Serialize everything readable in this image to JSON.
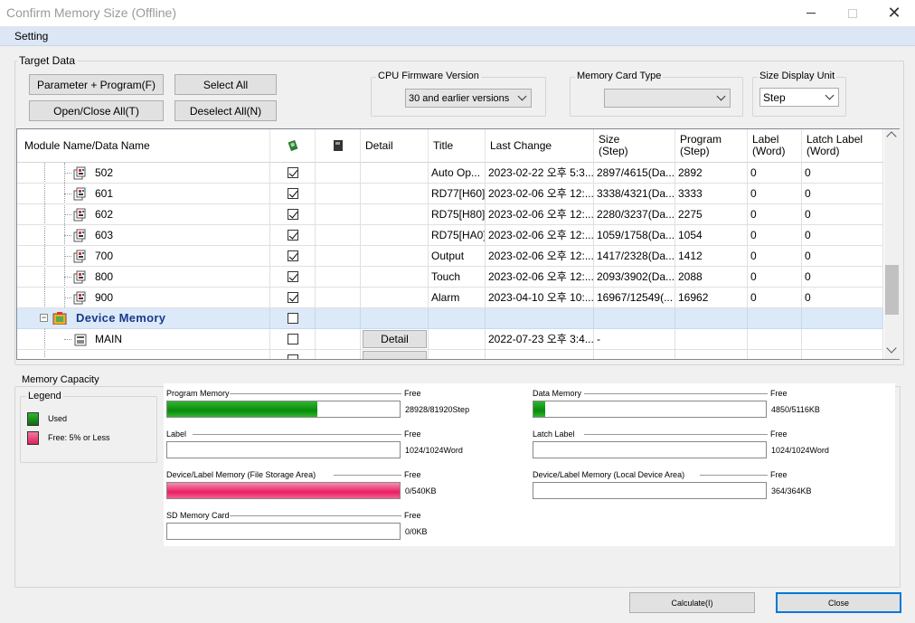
{
  "window": {
    "title": "Confirm Memory Size (Offline)"
  },
  "menu": {
    "setting": "Setting"
  },
  "target": {
    "group_title": "Target Data",
    "btn_param": "Parameter + Program(F)",
    "btn_open_close": "Open/Close All(T)",
    "btn_select_all": "Select All",
    "btn_deselect_all": "Deselect All(N)",
    "cpu_fw_label": "CPU Firmware Version",
    "cpu_fw_value": "30 and earlier versions",
    "card_label": "Memory Card Type",
    "card_value": "",
    "unit_label": "Size Display Unit",
    "unit_value": "Step"
  },
  "grid": {
    "headers": {
      "name": "Module Name/Data Name",
      "col_module_icon": "module-chip-icon",
      "col_card_icon": "memory-card-icon",
      "detail": "Detail",
      "title": "Title",
      "last_change": "Last Change",
      "size": "Size\n(Step)",
      "program": "Program\n(Step)",
      "label": "Label\n(Word)",
      "latch": "Latch Label\n(Word)"
    },
    "rows": [
      {
        "name": "502",
        "checked": true,
        "title": "Auto Op...",
        "last_change": "2023-02-22 오후 5:3...",
        "size": "2897/4615(Da...",
        "program": "2892",
        "label": "0",
        "latch": "0"
      },
      {
        "name": "601",
        "checked": true,
        "title": "RD77[H60]",
        "last_change": "2023-02-06 오후 12:...",
        "size": "3338/4321(Da...",
        "program": "3333",
        "label": "0",
        "latch": "0"
      },
      {
        "name": "602",
        "checked": true,
        "title": "RD75[H80]",
        "last_change": "2023-02-06 오후 12:...",
        "size": "2280/3237(Da...",
        "program": "2275",
        "label": "0",
        "latch": "0"
      },
      {
        "name": "603",
        "checked": true,
        "title": "RD75[HA0]",
        "last_change": "2023-02-06 오후 12:...",
        "size": "1059/1758(Da...",
        "program": "1054",
        "label": "0",
        "latch": "0"
      },
      {
        "name": "700",
        "checked": true,
        "title": "Output",
        "last_change": "2023-02-06 오후 12:...",
        "size": "1417/2328(Da...",
        "program": "1412",
        "label": "0",
        "latch": "0"
      },
      {
        "name": "800",
        "checked": true,
        "title": "Touch",
        "last_change": "2023-02-06 오후 12:...",
        "size": "2093/3902(Da...",
        "program": "2088",
        "label": "0",
        "latch": "0"
      },
      {
        "name": "900",
        "checked": true,
        "title": "Alarm",
        "last_change": "2023-04-10 오후 10:...",
        "size": "16967/12549(...",
        "program": "16962",
        "label": "0",
        "latch": "0"
      }
    ],
    "device_memory": {
      "name": "Device Memory",
      "checked": false
    },
    "main_row": {
      "name": "MAIN",
      "checked": false,
      "detail": "Detail",
      "last_change": "2022-07-23 오후 3:4...",
      "size": "-"
    }
  },
  "capacity": {
    "group_title": "Memory Capacity",
    "legend_title": "Legend",
    "legend_used": "Used",
    "legend_free": "Free: 5% or Less",
    "free_word": "Free",
    "colors": {
      "used": "#1aa01a",
      "free_low": "#e8457a"
    },
    "items": {
      "program": {
        "label": "Program Memory",
        "value": "28928/81920Step",
        "used_fraction": 0.647
      },
      "data": {
        "label": "Data Memory",
        "value": "4850/5116KB",
        "used_fraction": 0.052
      },
      "label": {
        "label": "Label",
        "value": "1024/1024Word",
        "used_fraction": 0
      },
      "latch": {
        "label": "Latch Label",
        "value": "1024/1024Word",
        "used_fraction": 0
      },
      "file_storage": {
        "label": "Device/Label Memory (File Storage Area)",
        "value": "0/540KB",
        "used_fraction": 1.0
      },
      "local_device": {
        "label": "Device/Label Memory (Local Device Area)",
        "value": "364/364KB",
        "used_fraction": 0
      },
      "sd_card": {
        "label": "SD Memory Card",
        "value": "0/0KB",
        "used_fraction": 0
      }
    }
  },
  "footer": {
    "calculate": "Calculate(I)",
    "close": "Close"
  }
}
